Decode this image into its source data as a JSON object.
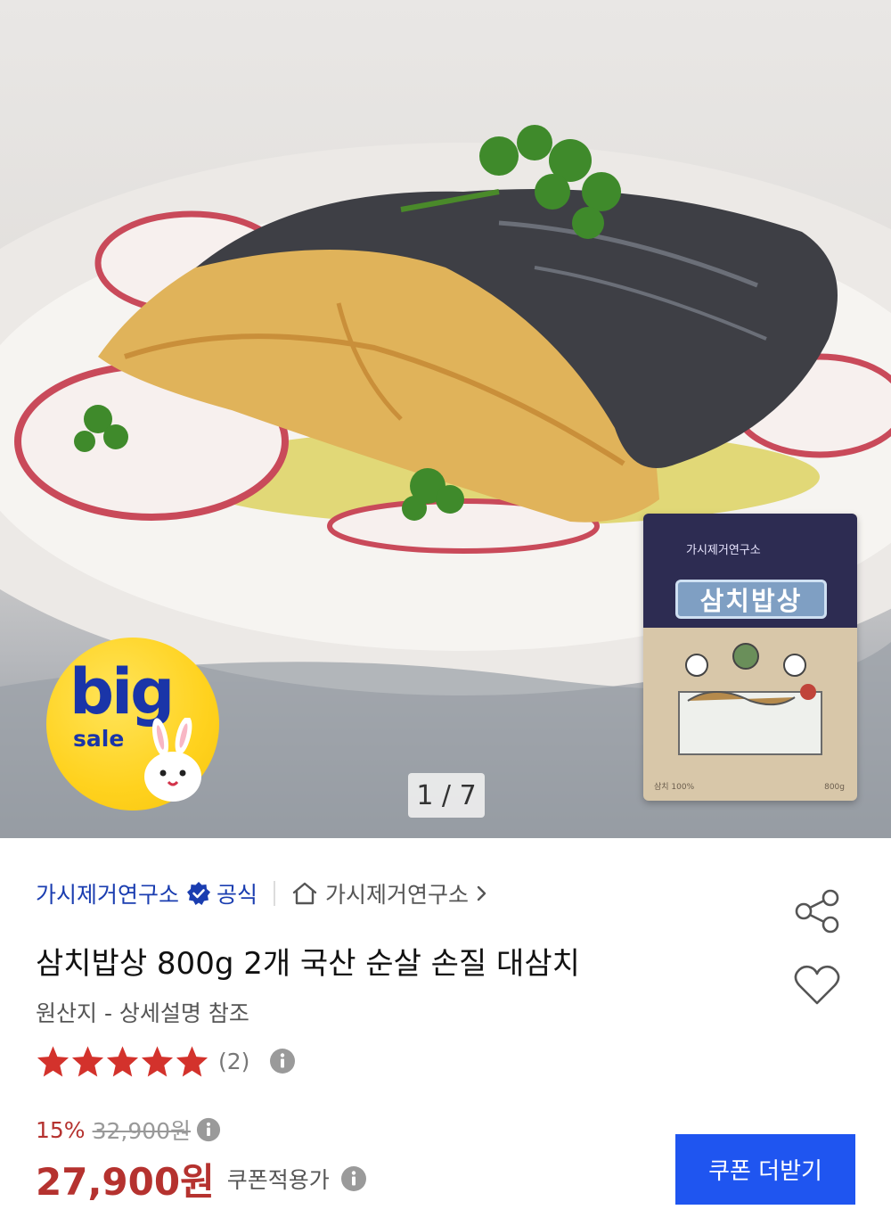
{
  "hero": {
    "pager": "1 / 7",
    "badge": {
      "big": "big",
      "sale": "sale"
    },
    "package": {
      "brand": "가시제거연구소",
      "title": "삼치밥상",
      "meta": "삼치 100%",
      "weight": "800g"
    }
  },
  "seller": {
    "name": "가시제거연구소",
    "official_label": "공식",
    "store_name": "가시제거연구소"
  },
  "product": {
    "title": "삼치밥상 800g 2개 국산 순살 손질 대삼치",
    "origin": "원산지 - 상세설명 참조"
  },
  "rating": {
    "stars": 5,
    "review_count": "(2)"
  },
  "price": {
    "discount": "15%",
    "original": "32,900원",
    "sale": "27,900원",
    "coupon_label": "쿠폰적용가"
  },
  "coupon_button": "쿠폰 더받기",
  "colors": {
    "accent_blue": "#1f55f0",
    "seller_blue": "#1a3db0",
    "price_red": "#b5322f",
    "star_red": "#d3322c"
  },
  "icons": [
    "verified-badge-icon",
    "home-icon",
    "chevron-right-icon",
    "share-icon",
    "heart-icon",
    "star-icon",
    "info-icon",
    "bunny-icon"
  ]
}
